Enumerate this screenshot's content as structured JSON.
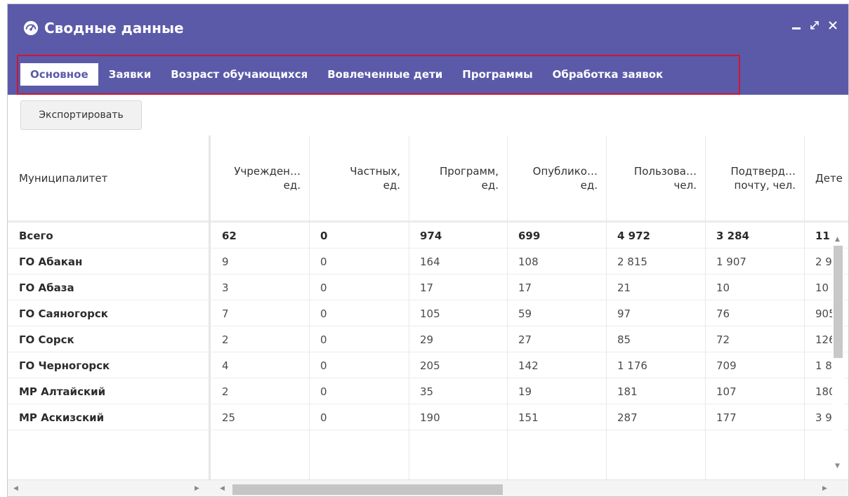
{
  "window": {
    "title": "Сводные данные",
    "icon": "dashboard-gauge-icon"
  },
  "tabs": [
    {
      "label": "Основное",
      "active": true
    },
    {
      "label": "Заявки",
      "active": false
    },
    {
      "label": "Возраст обучающихся",
      "active": false
    },
    {
      "label": "Вовлеченные дети",
      "active": false
    },
    {
      "label": "Программы",
      "active": false
    },
    {
      "label": "Обработка заявок",
      "active": false
    }
  ],
  "toolbar": {
    "export_label": "Экспортировать"
  },
  "table": {
    "headers": [
      {
        "line1": "Муниципалитет",
        "line2": ""
      },
      {
        "line1": "Учрежден…",
        "line2": "ед."
      },
      {
        "line1": "Частных,",
        "line2": "ед."
      },
      {
        "line1": "Программ,",
        "line2": "ед."
      },
      {
        "line1": "Опублико…",
        "line2": "ед."
      },
      {
        "line1": "Пользова…",
        "line2": "чел."
      },
      {
        "line1": "Подтверд…",
        "line2": "почту, чел."
      },
      {
        "line1": "Дете",
        "line2": ""
      }
    ],
    "rows": [
      {
        "name": "Всего",
        "v": [
          "62",
          "0",
          "974",
          "699",
          "4 972",
          "3 284",
          "11"
        ],
        "total": true
      },
      {
        "name": "ГО Абакан",
        "v": [
          "9",
          "0",
          "164",
          "108",
          "2 815",
          "1 907",
          "2 9"
        ]
      },
      {
        "name": "ГО Абаза",
        "v": [
          "3",
          "0",
          "17",
          "17",
          "21",
          "10",
          "10"
        ]
      },
      {
        "name": "ГО Саяногорск",
        "v": [
          "7",
          "0",
          "105",
          "59",
          "97",
          "76",
          "905"
        ]
      },
      {
        "name": "ГО Сорск",
        "v": [
          "2",
          "0",
          "29",
          "27",
          "85",
          "72",
          "126"
        ]
      },
      {
        "name": "ГО Черногорск",
        "v": [
          "4",
          "0",
          "205",
          "142",
          "1 176",
          "709",
          "1 8"
        ]
      },
      {
        "name": "МР Алтайский",
        "v": [
          "2",
          "0",
          "35",
          "19",
          "181",
          "107",
          "180"
        ]
      },
      {
        "name": "МР Аскизский",
        "v": [
          "25",
          "0",
          "190",
          "151",
          "287",
          "177",
          "3 9"
        ]
      }
    ]
  },
  "colors": {
    "header_bg": "#5b5aa9",
    "highlight_border": "#d3132d"
  }
}
